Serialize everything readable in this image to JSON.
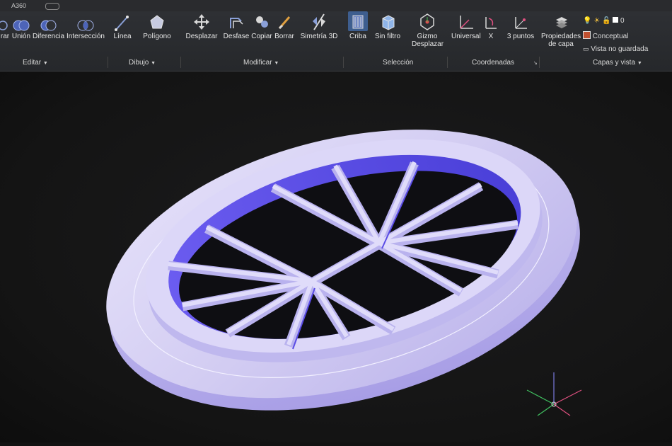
{
  "window": {
    "app_title": "A360"
  },
  "ribbon": {
    "tools": [
      {
        "id": "borrar",
        "label": "rar",
        "icon": "subtract-icon"
      },
      {
        "id": "union",
        "label": "Unión",
        "icon": "union-icon"
      },
      {
        "id": "diferencia",
        "label": "Diferencia",
        "icon": "difference-icon"
      },
      {
        "id": "interseccion",
        "label": "Intersección",
        "icon": "intersect-icon"
      },
      {
        "id": "linea",
        "label": "Línea",
        "icon": "line-icon"
      },
      {
        "id": "poligono",
        "label": "Polígono",
        "icon": "polygon-icon"
      },
      {
        "id": "desplazar",
        "label": "Desplazar",
        "icon": "move-icon"
      },
      {
        "id": "desfase",
        "label": "Desfase",
        "icon": "offset-icon"
      },
      {
        "id": "copiar",
        "label": "Copiar",
        "icon": "copy-icon"
      },
      {
        "id": "borrar2",
        "label": "Borrar",
        "icon": "erase-icon"
      },
      {
        "id": "simetria",
        "label": "Simetría 3D",
        "icon": "mirror-icon"
      },
      {
        "id": "criba",
        "label": "Criba",
        "icon": "cull-icon"
      },
      {
        "id": "sinfiltro",
        "label": "Sin filtro",
        "icon": "cube-icon"
      },
      {
        "id": "gizmo",
        "label": "Gizmo",
        "label2": "Desplazar",
        "icon": "gizmo-icon"
      },
      {
        "id": "universal",
        "label": "Universal",
        "icon": "ucs-world-icon"
      },
      {
        "id": "x",
        "label": "X",
        "icon": "ucs-x-icon"
      },
      {
        "id": "tres",
        "label": "3 puntos",
        "icon": "ucs-3point-icon"
      },
      {
        "id": "propiedades",
        "label": "Propiedades",
        "label2": "de capa",
        "icon": "layer-properties-icon"
      }
    ],
    "panels": {
      "editar": "Editar",
      "dibujo": "Dibujo",
      "modificar": "Modificar",
      "seleccion": "Selección",
      "coordenadas": "Coordenadas",
      "capas_vista": "Capas y vista"
    },
    "layer_value": "0",
    "visual_style": "Conceptual",
    "saved_view": "Vista no guardada"
  },
  "viewport": {
    "model_color": "#ccc6f0",
    "shadow_color": "#5d52e6",
    "hole_color": "#0e0e12"
  }
}
